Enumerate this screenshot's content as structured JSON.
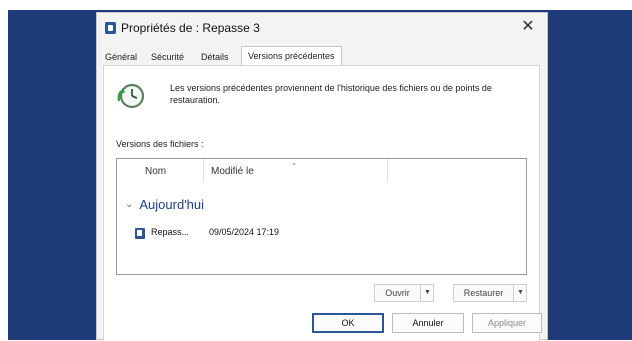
{
  "dialog": {
    "title": "Propriétés de : Repasse 3",
    "close_glyph": "✕"
  },
  "tabs": [
    {
      "label": "Général"
    },
    {
      "label": "Sécurité"
    },
    {
      "label": "Détails"
    },
    {
      "label": "Versions précédentes"
    }
  ],
  "panel": {
    "info_text": "Les versions précédentes proviennent de l'historique des fichiers ou de points de restauration.",
    "section_label": "Versions des fichiers :"
  },
  "list": {
    "columns": [
      {
        "label": "Nom"
      },
      {
        "label": "Modifié le"
      }
    ],
    "groups": [
      {
        "label": "Aujourd'hui",
        "items": [
          {
            "name": "Repass...",
            "modified": "09/05/2024 17:19",
            "icon": "word-document-icon"
          }
        ]
      }
    ],
    "group_chevron": "⌄"
  },
  "actions": {
    "open": "Ouvrir",
    "restore": "Restaurer",
    "dropdown_glyph": "▼"
  },
  "footer": {
    "ok": "OK",
    "cancel": "Annuler",
    "apply": "Appliquer"
  },
  "colors": {
    "desktop_background": "#1f3a78",
    "group_header": "#1e3f8a",
    "accent": "#2b5797"
  }
}
